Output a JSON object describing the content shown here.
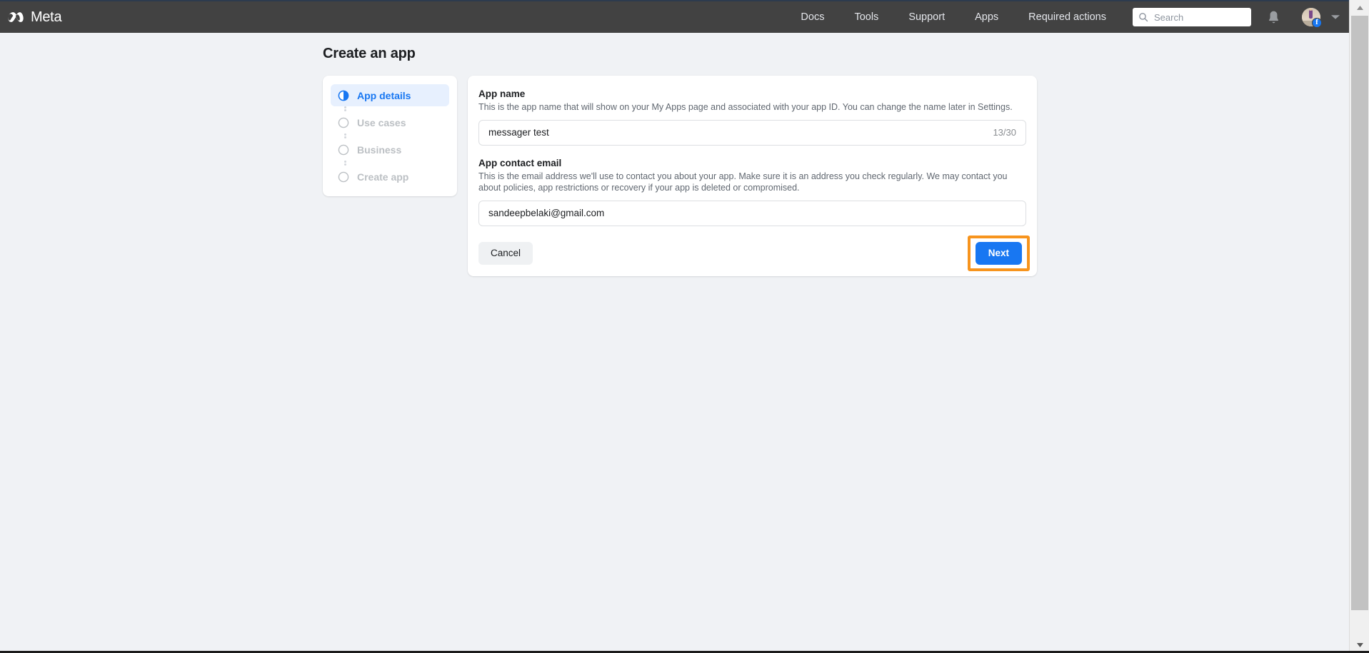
{
  "topnav": {
    "brand": "Meta",
    "brand_icon": "meta-infinity-logo",
    "links": [
      "Docs",
      "Tools",
      "Support",
      "Apps",
      "Required actions"
    ],
    "search": {
      "placeholder": "Search",
      "value": "",
      "icon": "search-icon"
    },
    "notifications_icon": "bell-icon",
    "avatar_badge": "f",
    "account_caret_icon": "chevron-down-icon",
    "background_color": "#424242"
  },
  "page": {
    "title": "Create an app",
    "background_color": "#f0f2f5"
  },
  "stepper": {
    "steps": [
      {
        "label": "App details",
        "state": "active",
        "icon": "half-filled-circle-icon"
      },
      {
        "label": "Use cases",
        "state": "pending",
        "icon": "empty-circle-icon"
      },
      {
        "label": "Business",
        "state": "pending",
        "icon": "empty-circle-icon"
      },
      {
        "label": "Create app",
        "state": "pending",
        "icon": "empty-circle-icon"
      }
    ],
    "active_color": "#1877f2",
    "active_background": "#e7f0fe",
    "pending_color": "#bcc0c4"
  },
  "form": {
    "app_name": {
      "label": "App name",
      "help": "This is the app name that will show on your My Apps page and associated with your app ID. You can change the name later in Settings.",
      "value": "messager test",
      "placeholder": "",
      "counter": "13/30"
    },
    "app_contact_email": {
      "label": "App contact email",
      "help": "This is the email address we'll use to contact you about your app. Make sure it is an address you check regularly. We may contact you about policies, app restrictions or recovery if your app is deleted or compromised.",
      "value": "sandeepbelaki@gmail.com",
      "placeholder": ""
    }
  },
  "actions": {
    "cancel_label": "Cancel",
    "next_label": "Next",
    "next_highlight_color": "#f7941d",
    "next_button_color": "#1877f2"
  },
  "scrollbar": {
    "up_arrow_icon": "triangle-up-icon",
    "down_arrow_icon": "triangle-down-icon"
  }
}
